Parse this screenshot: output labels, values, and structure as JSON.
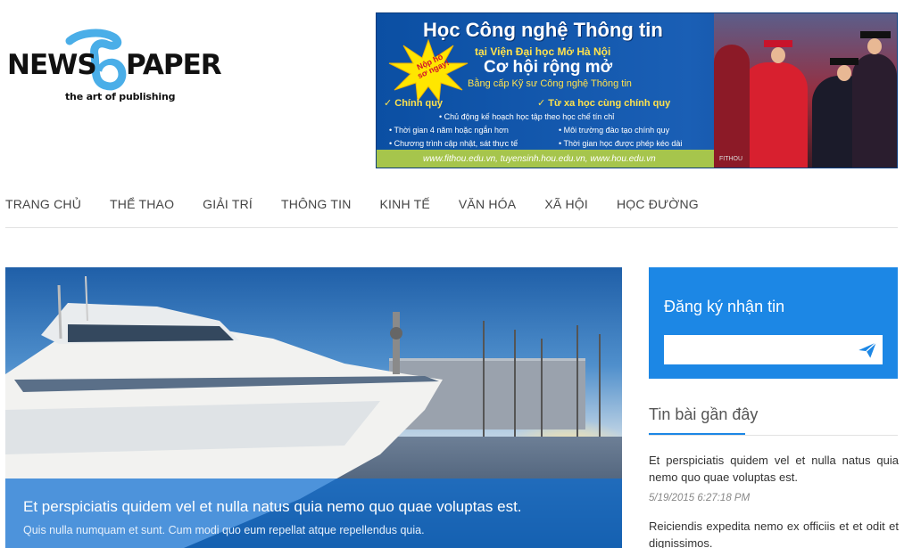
{
  "logo": {
    "word_left": "NEWS",
    "word_right": "PAPER",
    "tagline": "the art of publishing",
    "accent": "#4aaee8"
  },
  "banner": {
    "title": "Học Công nghệ Thông tin",
    "sub1": "tại Viện Đại học Mở Hà Nội",
    "sub2": "Cơ hội rộng mở",
    "sub3": "Bằng cấp Kỹ sư Công nghệ Thông tin",
    "star_text": "Nộp hồ sơ ngay!",
    "col_left_head": "✓ Chính quy",
    "col_right_head": "✓ Từ xa học cùng chính quy",
    "line_center": "• Chủ động kế hoạch học tập theo học chế tín chỉ",
    "left_lines": [
      "• Thời gian 4 năm hoặc ngắn hơn",
      "• Chương trình cập nhật, sát thực tế"
    ],
    "right_lines": [
      "• Môi trường đào tạo chính quy",
      "• Thời gian học được phép kéo dài"
    ],
    "urls": "www.fithou.edu.vn, tuyensinh.hou.edu.vn, www.hou.edu.vn",
    "photo_mark": "FITHOU"
  },
  "nav": {
    "items": [
      "TRANG CHỦ",
      "THỂ THAO",
      "GIẢI TRÍ",
      "THÔNG TIN",
      "KINH TẾ",
      "VĂN HÓA",
      "XÃ HỘI",
      "HỌC ĐƯỜNG"
    ]
  },
  "hero": {
    "title": "Et perspiciatis quidem vel et nulla natus quia nemo quo quae voluptas est.",
    "summary": "Quis nulla numquam et sunt. Cum modi quo eum repellat atque repellendus quia."
  },
  "subscribe": {
    "title": "Đăng ký nhận tin",
    "input_value": "",
    "send_icon": "paper-plane-icon",
    "color": "#1c87e5"
  },
  "recent": {
    "title": "Tin bài gần đây",
    "items": [
      {
        "title": "Et perspiciatis quidem vel et nulla natus quia nemo quo quae voluptas est.",
        "date": "5/19/2015 6:27:18 PM"
      },
      {
        "title": "Reiciendis expedita nemo ex officiis et et odit et dignissimos."
      }
    ]
  }
}
